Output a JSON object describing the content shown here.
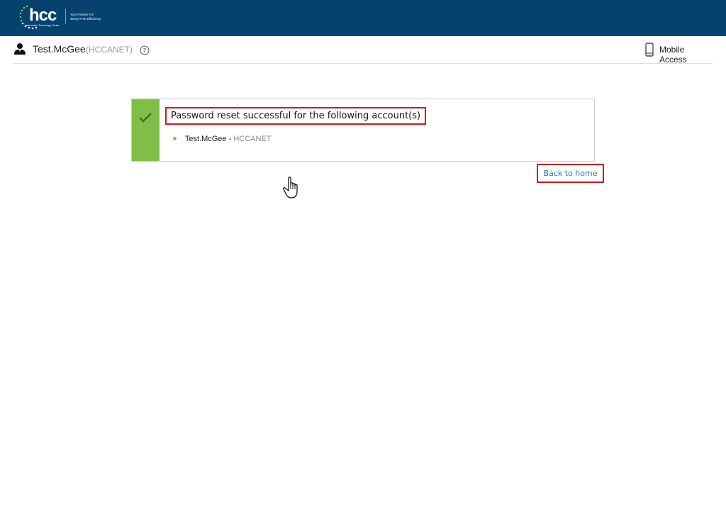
{
  "header": {
    "logo_text": "hcc",
    "logo_subtext": "Information Technology Center",
    "tagline_line1": "Your Partner For",
    "tagline_line2": "Worry-Free Efficiency"
  },
  "userbar": {
    "username": "Test.McGee",
    "domain": "(HCCANET)",
    "mobile_label": "Mobile Access"
  },
  "result": {
    "message": "Password reset successful for the following account(s)",
    "accounts": [
      {
        "name": "Test.McGee",
        "separator": " - ",
        "domain": "HCCANET"
      }
    ]
  },
  "actions": {
    "back_label": "Back to home"
  },
  "colors": {
    "topbar": "#05426e",
    "success_stripe": "#7fbf48",
    "link": "#1a7fc1",
    "highlight": "#d6151b"
  },
  "icons": [
    "user-icon",
    "help-icon",
    "mobile-phone-icon",
    "checkmark-icon",
    "hand-pointer-icon"
  ]
}
